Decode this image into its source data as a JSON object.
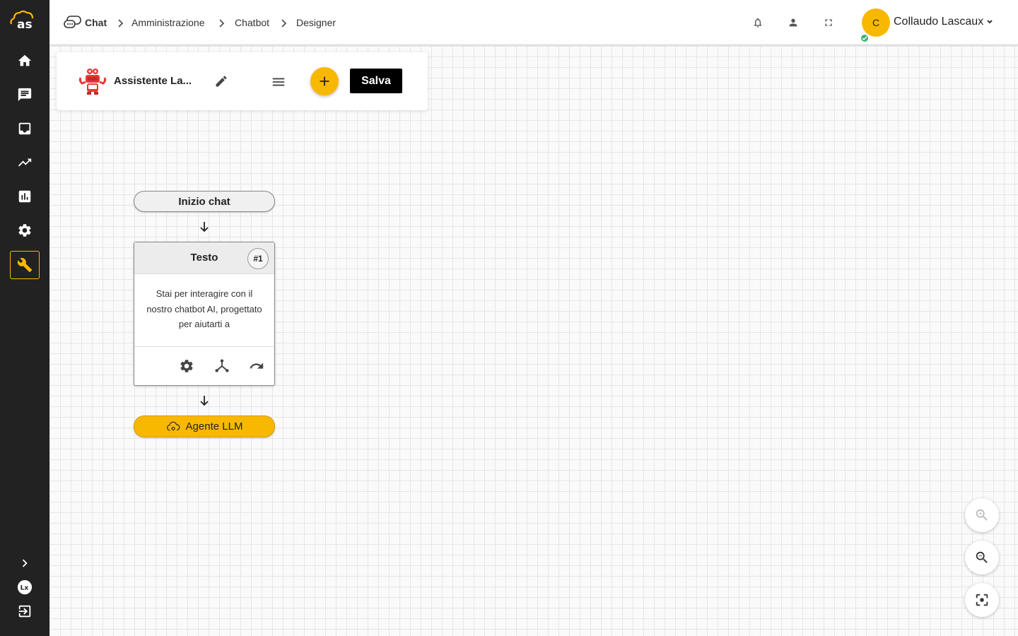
{
  "breadcrumb": {
    "items": [
      {
        "label": "Chat"
      },
      {
        "label": "Amministrazione"
      },
      {
        "label": "Chatbot"
      },
      {
        "label": "Designer"
      }
    ]
  },
  "user": {
    "initial": "C",
    "name": "Collaudo Lascaux",
    "status": "online"
  },
  "sidebar": {
    "items": [
      "home-icon",
      "chat-icon",
      "inbox-icon",
      "trending-icon",
      "chart-icon",
      "settings-icon",
      "wrench-icon"
    ],
    "active": "wrench-icon"
  },
  "toolbar": {
    "bot_name": "Assistente La...",
    "save_label": "Salva"
  },
  "flow": {
    "start_label": "Inizio chat",
    "text_node": {
      "title": "Testo",
      "number": "#1",
      "body": "Stai per interagire con il nostro chatbot AI, progettato per aiutarti a"
    },
    "llm_node": {
      "label": "Agente LLM"
    }
  },
  "colors": {
    "accent": "#f9b800",
    "sidebar_bg": "#222222",
    "online": "#3cb371"
  }
}
